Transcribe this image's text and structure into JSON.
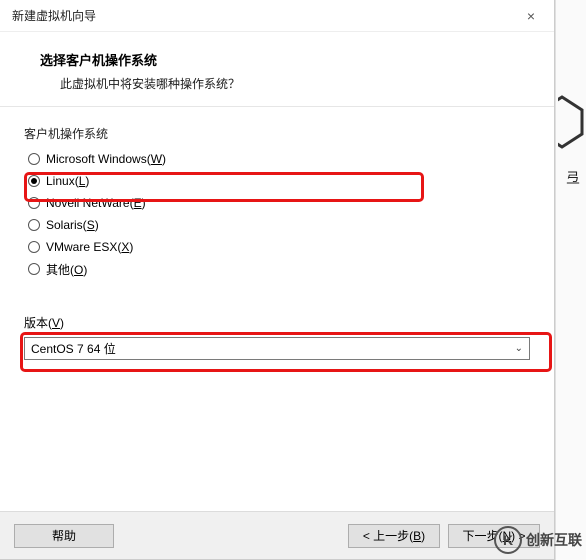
{
  "titlebar": {
    "title": "新建虚拟机向导",
    "close_icon": "×"
  },
  "header": {
    "heading": "选择客户机操作系统",
    "sub": "此虚拟机中将安装哪种操作系统？"
  },
  "os_group": {
    "label": "客户机操作系统",
    "options": [
      {
        "text": "Microsoft Windows(",
        "hotkey": "W",
        "tail": ")",
        "checked": false
      },
      {
        "text": "Linux(",
        "hotkey": "L",
        "tail": ")",
        "checked": true
      },
      {
        "text": "Novell NetWare(",
        "hotkey": "E",
        "tail": ")",
        "checked": false
      },
      {
        "text": "Solaris(",
        "hotkey": "S",
        "tail": ")",
        "checked": false
      },
      {
        "text": "VMware ESX(",
        "hotkey": "X",
        "tail": ")",
        "checked": false
      },
      {
        "text": "其他(",
        "hotkey": "O",
        "tail": ")",
        "checked": false
      }
    ]
  },
  "version": {
    "label_pre": "版本(",
    "label_hotkey": "V",
    "label_post": ")",
    "selected": "CentOS 7 64 位"
  },
  "footer": {
    "help": "帮助",
    "back_pre": "< 上一步(",
    "back_hotkey": "B",
    "back_post": ")",
    "next_pre": "下一步(",
    "next_hotkey": "N",
    "next_post": ") >"
  },
  "sidebar": {
    "char": "弖"
  },
  "watermark": {
    "logo": "K",
    "text": "创新互联"
  }
}
